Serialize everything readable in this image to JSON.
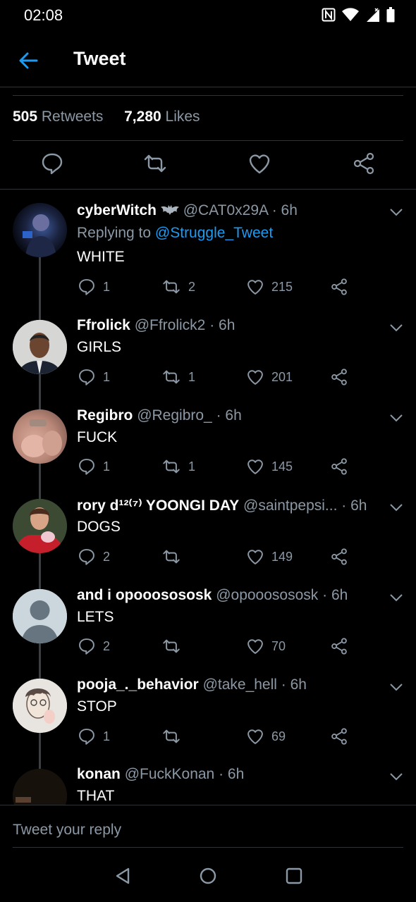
{
  "status_bar": {
    "time": "02:08"
  },
  "header": {
    "title": "Tweet"
  },
  "stats": {
    "retweets_count": "505",
    "retweets_label": "Retweets",
    "likes_count": "7,280",
    "likes_label": "Likes"
  },
  "reply_composer": {
    "placeholder": "Tweet your reply"
  },
  "replies": [
    {
      "name": "cyberWitch",
      "handle": "@CAT0x29A",
      "time": "· 6h",
      "replying_prefix": "Replying to",
      "replying_to": "@Struggle_Tweet",
      "text": "WHITE",
      "replies": "1",
      "retweets": "2",
      "likes": "215"
    },
    {
      "name": "Ffrolick",
      "handle": "@Ffrolick2",
      "time": "· 6h",
      "text": "GIRLS",
      "replies": "1",
      "retweets": "1",
      "likes": "201"
    },
    {
      "name": "Regibro",
      "handle": "@Regibro_",
      "time": "· 6h",
      "text": "FUCK",
      "replies": "1",
      "retweets": "1",
      "likes": "145"
    },
    {
      "name": "rory d¹²⁽⁷⁾ YOONGI DAY",
      "handle": "@saintpepsi...",
      "time": "· 6h",
      "text": "DOGS",
      "replies": "2",
      "retweets": "",
      "likes": "149"
    },
    {
      "name": "and i opooosososk",
      "handle": "@opooosososk",
      "time": "· 6h",
      "text": "LETS",
      "replies": "2",
      "retweets": "",
      "likes": "70"
    },
    {
      "name": "pooja_._behavior",
      "handle": "@take_hell",
      "time": "· 6h",
      "text": "STOP",
      "replies": "1",
      "retweets": "",
      "likes": "69"
    },
    {
      "name": "konan",
      "handle": "@FuckKonan",
      "time": "· 6h",
      "text": "THAT"
    }
  ],
  "colors": {
    "background": "#000000",
    "accent": "#1d9bf0",
    "secondary_text": "#8b98a5",
    "divider": "#2f3336"
  }
}
